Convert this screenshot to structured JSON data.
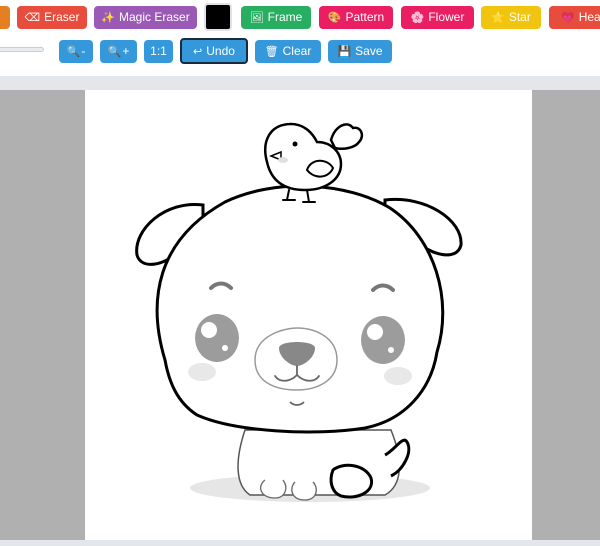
{
  "toolbar": {
    "row1": [
      {
        "name": "eraser-button",
        "icon": "⌫",
        "label": "Eraser",
        "color": "#e74c3c"
      },
      {
        "name": "magic-eraser-button",
        "icon": "✨",
        "label": "Magic Eraser",
        "color": "#9b59b6"
      },
      {
        "name": "frame-button",
        "icon": "🖼",
        "label": "Frame",
        "color": "#27ae60"
      },
      {
        "name": "pattern-button",
        "icon": "🎨",
        "label": "Pattern",
        "color": "#e91e63"
      },
      {
        "name": "flower-button",
        "icon": "🌸",
        "label": "Flower",
        "color": "#e91e63"
      },
      {
        "name": "star-button",
        "icon": "⭐",
        "label": "Star",
        "color": "#f1c40f"
      },
      {
        "name": "heart-button",
        "icon": "💗",
        "label": "Heart",
        "color": "#e74c3c"
      }
    ],
    "color_swatch": "#000000",
    "row2": [
      {
        "name": "zoom-out-button",
        "icon": "🔍",
        "label": "-",
        "color": "#3498db"
      },
      {
        "name": "zoom-in-button",
        "icon": "🔍",
        "label": "+",
        "color": "#3498db"
      },
      {
        "name": "zoom-reset-button",
        "icon": "",
        "label": "1:1",
        "color": "#3498db"
      },
      {
        "name": "undo-button",
        "icon": "↩",
        "label": "Undo",
        "color": "#3498db"
      },
      {
        "name": "clear-button",
        "icon": "🗑",
        "label": "Clear",
        "color": "#3498db"
      },
      {
        "name": "save-button",
        "icon": "💾",
        "label": "Save",
        "color": "#3498db"
      }
    ]
  },
  "colors": {
    "toolbar_bg": "#ffffff",
    "workspace_bg": "#e3e7ec",
    "canvas_bg": "#b0b0b0",
    "paper_bg": "#ffffff",
    "partial_left_button": "#e67e22",
    "undo_border": "#1a2b3c"
  },
  "canvas": {
    "drawing": "puppy-with-bird-line-art"
  }
}
